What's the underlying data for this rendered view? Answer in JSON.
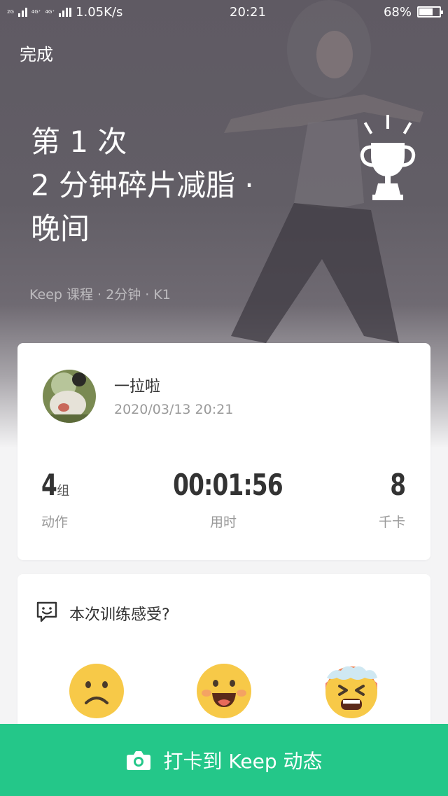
{
  "status_bar": {
    "network_left": "2G",
    "network_mid": "4G⁺",
    "network_right": "4G⁺",
    "speed": "1.05K/s",
    "time": "20:21",
    "battery": "68%",
    "battery_level": 0.68
  },
  "header": {
    "done_label": "完成",
    "title_line1": "第 1 次",
    "title_line2": "2 分钟碎片减脂 ·",
    "title_line3": "晚间",
    "subtitle": "Keep 课程 · 2分钟 · K1",
    "trophy_icon": "trophy-icon"
  },
  "summary": {
    "username": "一拉啦",
    "datetime": "2020/03/13 20:21",
    "stats": [
      {
        "value": "4",
        "unit": "组",
        "label": "动作"
      },
      {
        "value": "00:01:56",
        "unit": "",
        "label": "用时"
      },
      {
        "value": "8",
        "unit": "",
        "label": "千卡"
      }
    ]
  },
  "feedback": {
    "title": "本次训练感受?",
    "icon": "chat-smile-icon",
    "options": [
      "sad-face-icon",
      "happy-face-icon",
      "exhausted-face-icon"
    ]
  },
  "bottom_bar": {
    "label": "打卡到 Keep 动态",
    "icon": "camera-icon",
    "color": "#24c789"
  }
}
